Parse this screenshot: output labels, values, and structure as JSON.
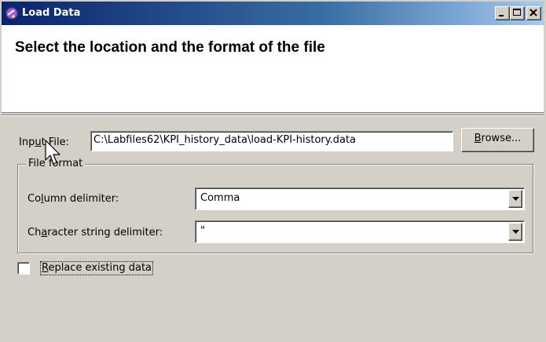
{
  "window": {
    "title": "Load Data",
    "app_icon": "wand-icon",
    "controls": [
      "minimize-icon",
      "maximize-icon",
      "close-icon"
    ]
  },
  "banner": {
    "title": "Select the location and the format of the file"
  },
  "input_file": {
    "label_before": "Inp",
    "label_mnemonic": "u",
    "label_after": "t File:",
    "value": "C:\\Labfiles62\\KPI_history_data\\load-KPI-history.data",
    "browse_mnemonic": "B",
    "browse_rest": "rowse..."
  },
  "file_format": {
    "legend": "File format",
    "column_delimiter": {
      "label_before": "Co",
      "label_mnemonic": "l",
      "label_after": "umn delimiter:",
      "value": "Comma"
    },
    "string_delimiter": {
      "label_before": "Ch",
      "label_mnemonic": "a",
      "label_after": "racter string delimiter:",
      "value": "\""
    }
  },
  "replace_existing": {
    "label_mnemonic": "R",
    "label_rest": "eplace existing data",
    "checked": false
  },
  "colors": {
    "title_bar_start": "#0a246a",
    "title_bar_end": "#a6caf0",
    "face": "#d4d0c8",
    "banner_bg": "#ffffff"
  }
}
